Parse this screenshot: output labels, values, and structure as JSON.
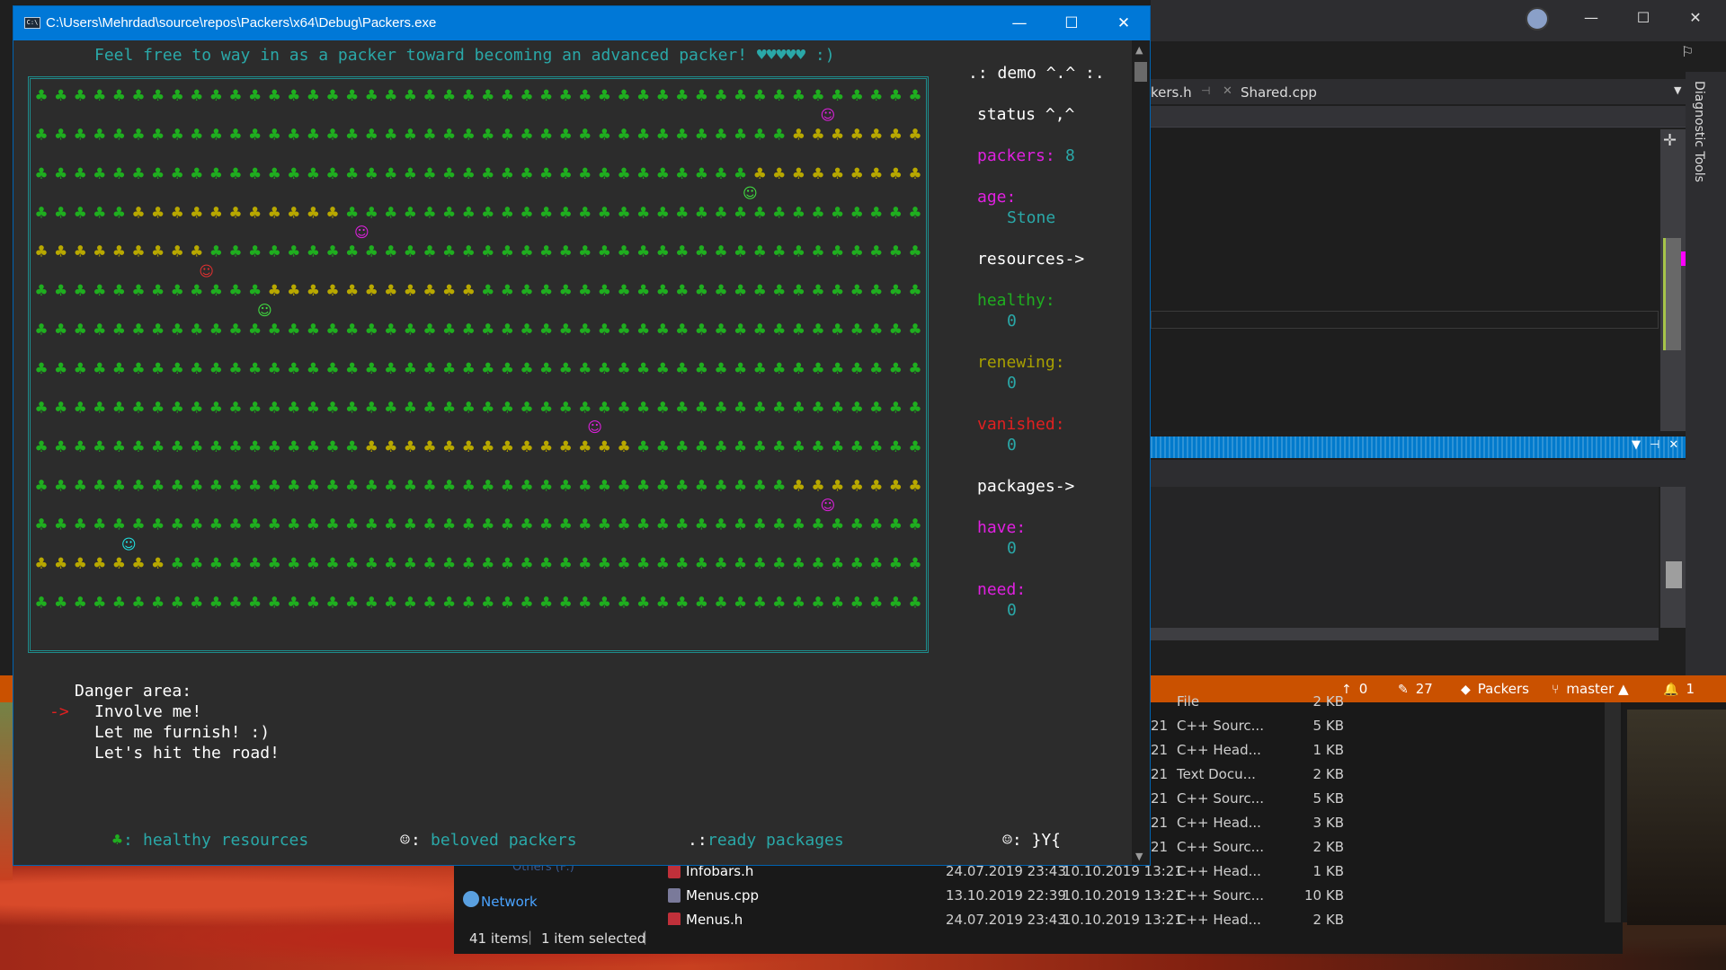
{
  "console": {
    "title": "C:\\Users\\Mehrdad\\source\\repos\\Packers\\x64\\Debug\\Packers.exe",
    "icon_glyph": "C:\\",
    "header_line": "Feel free to way in as a packer toward becoming an advanced packer! ♥♥♥♥♥ :)",
    "side": {
      "demo": ".: demo ^.^ :.",
      "status": "status ^,^",
      "packers_label": "packers:",
      "packers_value": "8",
      "age_label": "age:",
      "age_value": "Stone",
      "resources": "resources->",
      "healthy_label": "healthy:",
      "healthy_value": "0",
      "renewing_label": "renewing:",
      "renewing_value": "0",
      "vanished_label": "vanished:",
      "vanished_value": "0",
      "packages": "packages->",
      "have_label": "have:",
      "have_value": "0",
      "need_label": "need:",
      "need_value": "0"
    },
    "menu": {
      "title": "Danger area:",
      "arrow": "->",
      "items": [
        "Involve me!",
        "Let me furnish! :)",
        "Let's hit the road!"
      ],
      "selected_index": 0
    },
    "legend": {
      "healthy_glyph": "♣",
      "healthy": "healthy resources",
      "packer_glyph": "☺",
      "packers": "beloved packers",
      "packages_glyph": ".:",
      "packages": "ready packages",
      "face": "☺: }Y{"
    },
    "grid": {
      "rows": 14,
      "cols": 46,
      "club_glyph": "♣",
      "packer_glyph": "☺",
      "colors": {
        "green": "#1fae1f",
        "olive": "#b8a800",
        "magenta": "#e020e0",
        "red": "#e03030",
        "lime": "#40e040",
        "cyan": "#20e0e0"
      },
      "olive_cells": [
        [
          1,
          39,
          45
        ],
        [
          2,
          37,
          45
        ],
        [
          3,
          5,
          15
        ],
        [
          4,
          0,
          8
        ],
        [
          5,
          12,
          22
        ],
        [
          9,
          17,
          30
        ],
        [
          10,
          39,
          45
        ],
        [
          12,
          0,
          6
        ]
      ],
      "packers": [
        {
          "row": 0.5,
          "col": 40.5,
          "color": "magenta"
        },
        {
          "row": 2.5,
          "col": 36.5,
          "color": "lime"
        },
        {
          "row": 3.5,
          "col": 16.5,
          "color": "magenta"
        },
        {
          "row": 4.5,
          "col": 8.5,
          "color": "red"
        },
        {
          "row": 5.5,
          "col": 11.5,
          "color": "lime"
        },
        {
          "row": 8.5,
          "col": 28.5,
          "color": "magenta"
        },
        {
          "row": 10.5,
          "col": 40.5,
          "color": "magenta"
        },
        {
          "row": 11.5,
          "col": 4.5,
          "color": "cyan"
        }
      ]
    }
  },
  "vs": {
    "tab1_label": "kers.h",
    "tab2_label": "Shared.cpp",
    "side_label": "Diagnostic Tools",
    "statusbar": {
      "up_count": "0",
      "edit_count": "27",
      "repo": "Packers",
      "branch": "master",
      "notifications": "1"
    }
  },
  "explorer": {
    "nav_others": "Others (F:)",
    "nav_network": "Network",
    "partial_rows": [
      {
        "date": "21",
        "type": "C++ Sourc...",
        "size": "5 KB"
      },
      {
        "date": "21",
        "type": "C++ Head...",
        "size": "1 KB"
      },
      {
        "date": "21",
        "type": "Text Docu...",
        "size": "2 KB"
      },
      {
        "date": "21",
        "type": "C++ Sourc...",
        "size": "5 KB"
      },
      {
        "date": "21",
        "type": "C++ Head...",
        "size": "3 KB"
      },
      {
        "date": "21",
        "type": "C++ Sourc...",
        "size": "2 KB"
      }
    ],
    "partial_top": {
      "type": "File",
      "size": "2 KB"
    },
    "files": [
      {
        "name": "Infobars.h",
        "modified": "24.07.2019 23:43",
        "created": "10.10.2019 13:21",
        "type": "C++ Head...",
        "size": "1 KB",
        "kind": "h"
      },
      {
        "name": "Menus.cpp",
        "modified": "13.10.2019 22:39",
        "created": "10.10.2019 13:21",
        "type": "C++ Sourc...",
        "size": "10 KB",
        "kind": "cpp"
      },
      {
        "name": "Menus.h",
        "modified": "24.07.2019 23:43",
        "created": "10.10.2019 13:21",
        "type": "C++ Head...",
        "size": "2 KB",
        "kind": "h"
      }
    ],
    "status_items": "41 items",
    "status_selected": "1 item selected"
  }
}
